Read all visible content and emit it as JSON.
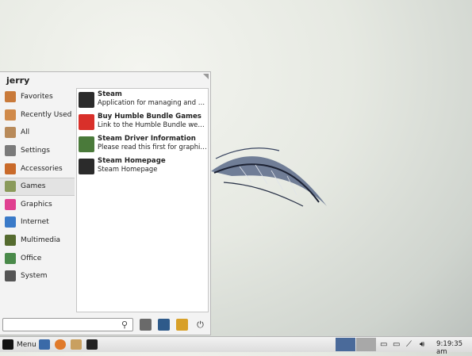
{
  "user": {
    "name": "jerry"
  },
  "categories": [
    {
      "label": "Favorites",
      "color": "#c97a3a"
    },
    {
      "label": "Recently Used",
      "color": "#d08a4a"
    },
    {
      "label": "All",
      "color": "#b88a5a"
    },
    {
      "label": "Settings",
      "color": "#7a7a7a"
    },
    {
      "label": "Accessories",
      "color": "#c96a2a"
    },
    {
      "label": "Games",
      "color": "#8a9a5a"
    },
    {
      "label": "Graphics",
      "color": "#e04090"
    },
    {
      "label": "Internet",
      "color": "#3a7ac8"
    },
    {
      "label": "Multimedia",
      "color": "#556b2f"
    },
    {
      "label": "Office",
      "color": "#4a8a4a"
    },
    {
      "label": "System",
      "color": "#555555"
    }
  ],
  "selected_category": "Games",
  "apps": [
    {
      "name": "Steam",
      "desc": "Application for managing and pla...",
      "color": "#2b2b2b"
    },
    {
      "name": "Buy Humble Bundle Games",
      "desc": "Link to the Humble Bundle website",
      "color": "#d9302a"
    },
    {
      "name": "Steam Driver Information",
      "desc": "Please read this first for graphics ...",
      "color": "#4a7a3a"
    },
    {
      "name": "Steam Homepage",
      "desc": "Steam Homepage",
      "color": "#2b2b2b"
    }
  ],
  "search": {
    "value": "",
    "placeholder": ""
  },
  "taskbar": {
    "menu_label": "Menu",
    "clock": "9:19:35 am"
  }
}
